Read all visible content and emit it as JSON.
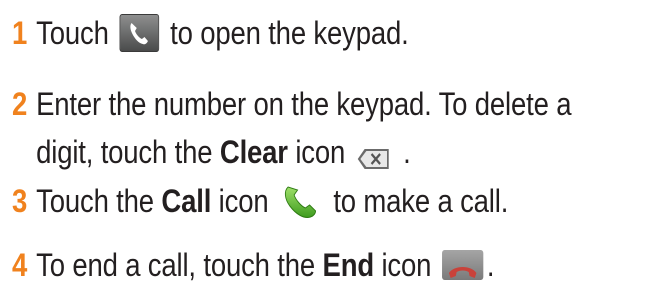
{
  "steps": [
    {
      "number": "1",
      "before": "Touch",
      "after": "to open the keypad."
    },
    {
      "number": "2",
      "line1": "Enter the number on the keypad. To delete a",
      "line2_before": "digit, touch the",
      "bold": "Clear",
      "line2_mid": "icon",
      "line2_after": "."
    },
    {
      "number": "3",
      "before": "Touch the",
      "bold": "Call",
      "mid": "icon",
      "after": "to make a call."
    },
    {
      "number": "4",
      "before": "To end a call, touch the",
      "bold": "End",
      "mid": "icon",
      "after": "."
    }
  ],
  "icons": {
    "step1": "phone-app-icon",
    "step2": "clear-icon",
    "step3": "call-icon",
    "step4": "end-call-icon"
  },
  "colors": {
    "step_number": "#f0821e",
    "text": "#231f20"
  }
}
